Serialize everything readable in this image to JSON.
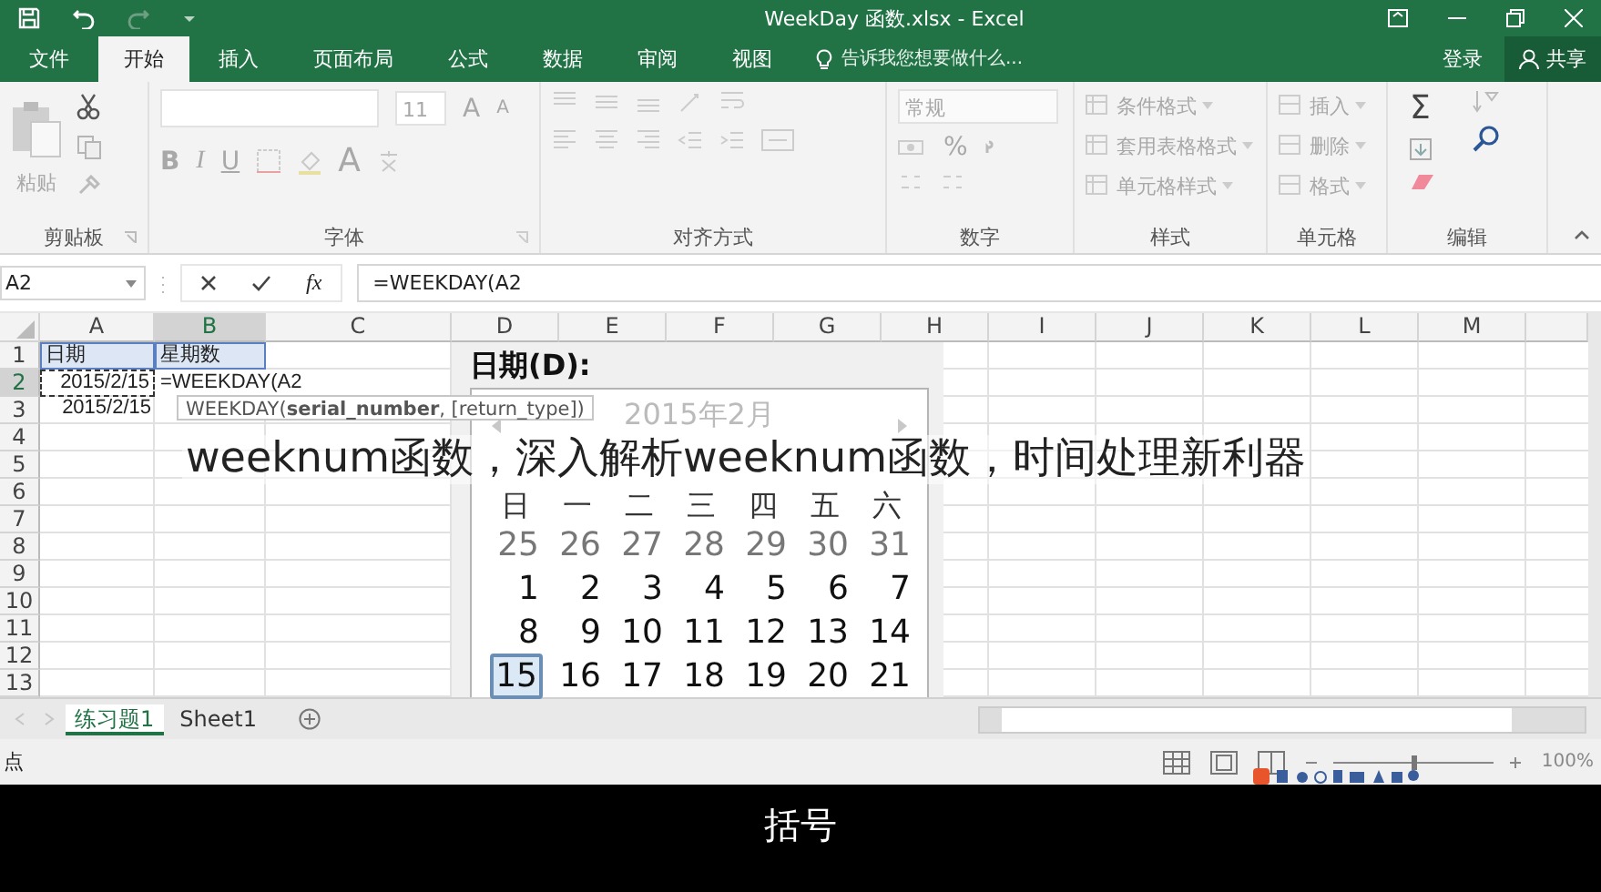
{
  "window": {
    "title": "WeekDay 函数.xlsx - Excel"
  },
  "ribbon_tabs": [
    {
      "label": "文件",
      "selected": false
    },
    {
      "label": "开始",
      "selected": true
    },
    {
      "label": "插入",
      "selected": false
    },
    {
      "label": "页面布局",
      "selected": false
    },
    {
      "label": "公式",
      "selected": false
    },
    {
      "label": "数据",
      "selected": false
    },
    {
      "label": "审阅",
      "selected": false
    },
    {
      "label": "视图",
      "selected": false
    }
  ],
  "tell_me": {
    "placeholder": "告诉我您想要做什么..."
  },
  "sign_in": "登录",
  "share": "共享",
  "ribbon": {
    "disabled": true,
    "clipboard": {
      "paste": "粘贴",
      "label": "剪贴板"
    },
    "font": {
      "size": "11",
      "grow": "A",
      "shrink": "A",
      "bold": "B",
      "italic": "I",
      "underline": "U",
      "font_color_button": "A",
      "label": "字体"
    },
    "alignment": {
      "label": "对齐方式"
    },
    "number": {
      "format": "常规",
      "percent": "%",
      "label": "数字"
    },
    "styles": {
      "items": [
        "条件格式",
        "套用表格格式",
        "单元格样式"
      ],
      "label": "样式"
    },
    "cells": {
      "items": [
        "插入",
        "删除",
        "格式"
      ],
      "label": "单元格"
    },
    "editing": {
      "sum": "Σ",
      "label": "编辑"
    }
  },
  "formula_bar": {
    "name_box": "A2",
    "function_label": "fx",
    "formula": "=WEEKDAY(A2"
  },
  "grid": {
    "columns": [
      {
        "label": "A",
        "selected": false
      },
      {
        "label": "B",
        "selected": true
      },
      {
        "label": "C",
        "selected": false
      },
      {
        "label": "D",
        "selected": false
      },
      {
        "label": "E",
        "selected": false
      },
      {
        "label": "F",
        "selected": false
      },
      {
        "label": "G",
        "selected": false
      },
      {
        "label": "H",
        "selected": false
      },
      {
        "label": "I",
        "selected": false
      },
      {
        "label": "J",
        "selected": false
      },
      {
        "label": "K",
        "selected": false
      },
      {
        "label": "L",
        "selected": false
      },
      {
        "label": "M",
        "selected": false
      }
    ],
    "rows": [
      {
        "label": "1",
        "selected": false,
        "cells": [
          {
            "text": "日期",
            "kind": "header"
          },
          {
            "text": "星期数",
            "kind": "header"
          }
        ]
      },
      {
        "label": "2",
        "selected": true,
        "cells": [
          {
            "text": "2015/2/15",
            "kind": "reference"
          },
          {
            "text": "=WEEKDAY(A2",
            "kind": "editing"
          }
        ]
      },
      {
        "label": "3",
        "selected": false,
        "cells": [
          {
            "text": "2015/2/15",
            "kind": "date"
          }
        ]
      },
      {
        "label": "4",
        "selected": false
      },
      {
        "label": "5",
        "selected": false
      },
      {
        "label": "6",
        "selected": false
      },
      {
        "label": "7",
        "selected": false
      },
      {
        "label": "8",
        "selected": false
      },
      {
        "label": "9",
        "selected": false
      },
      {
        "label": "10",
        "selected": false
      },
      {
        "label": "11",
        "selected": false
      },
      {
        "label": "12",
        "selected": false
      },
      {
        "label": "13",
        "selected": false
      }
    ]
  },
  "tooltip": "WEEKDAY(**serial_number**, [return_type])",
  "date_picker": {
    "label": "日期(D):",
    "month": "2015年2月",
    "weekdays": [
      "日",
      "一",
      "二",
      "三",
      "四",
      "五",
      "六"
    ],
    "weeks": [
      [
        {
          "day": "25",
          "other_month": true,
          "selected": false
        },
        {
          "day": "26",
          "other_month": true,
          "selected": false
        },
        {
          "day": "27",
          "other_month": true,
          "selected": false
        },
        {
          "day": "28",
          "other_month": true,
          "selected": false
        },
        {
          "day": "29",
          "other_month": true,
          "selected": false
        },
        {
          "day": "30",
          "other_month": true,
          "selected": false
        },
        {
          "day": "31",
          "other_month": true,
          "selected": false
        }
      ],
      [
        {
          "day": "1",
          "other_month": false,
          "selected": false
        },
        {
          "day": "2",
          "other_month": false,
          "selected": false
        },
        {
          "day": "3",
          "other_month": false,
          "selected": false
        },
        {
          "day": "4",
          "other_month": false,
          "selected": false
        },
        {
          "day": "5",
          "other_month": false,
          "selected": false
        },
        {
          "day": "6",
          "other_month": false,
          "selected": false
        },
        {
          "day": "7",
          "other_month": false,
          "selected": false
        }
      ],
      [
        {
          "day": "8",
          "other_month": false,
          "selected": false
        },
        {
          "day": "9",
          "other_month": false,
          "selected": false
        },
        {
          "day": "10",
          "other_month": false,
          "selected": false
        },
        {
          "day": "11",
          "other_month": false,
          "selected": false
        },
        {
          "day": "12",
          "other_month": false,
          "selected": false
        },
        {
          "day": "13",
          "other_month": false,
          "selected": false
        },
        {
          "day": "14",
          "other_month": false,
          "selected": false
        }
      ],
      [
        {
          "day": "15",
          "other_month": false,
          "selected": true
        },
        {
          "day": "16",
          "other_month": false,
          "selected": false
        },
        {
          "day": "17",
          "other_month": false,
          "selected": false
        },
        {
          "day": "18",
          "other_month": false,
          "selected": false
        },
        {
          "day": "19",
          "other_month": false,
          "selected": false
        },
        {
          "day": "20",
          "other_month": false,
          "selected": false
        },
        {
          "day": "21",
          "other_month": false,
          "selected": false
        }
      ]
    ]
  },
  "sheet_tabs": [
    {
      "label": "练习题1",
      "selected": true
    },
    {
      "label": "Sheet1",
      "selected": false
    }
  ],
  "status_bar": {
    "mode": "点",
    "zoom": "100%"
  },
  "overlay_caption": "weeknum函数，深入解析weeknum函数，时间处理新利器",
  "subtitle": "括号"
}
